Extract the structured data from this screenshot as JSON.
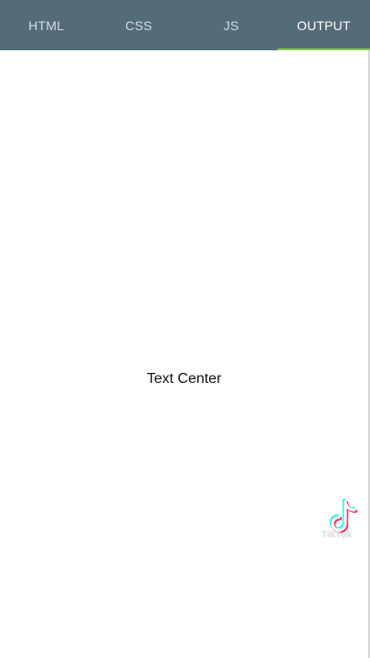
{
  "tabs": [
    {
      "label": "HTML",
      "active": false
    },
    {
      "label": "CSS",
      "active": false
    },
    {
      "label": "JS",
      "active": false
    },
    {
      "label": "OUTPUT",
      "active": true
    }
  ],
  "colors": {
    "tabbar_bg": "#546b78",
    "active_indicator": "#7fc83f",
    "tab_text": "#d5dde2",
    "active_tab_text": "#ffffff"
  },
  "output": {
    "text": "Text Center"
  },
  "watermark": {
    "icon": "tiktok-logo-icon",
    "text": "TikTok"
  }
}
